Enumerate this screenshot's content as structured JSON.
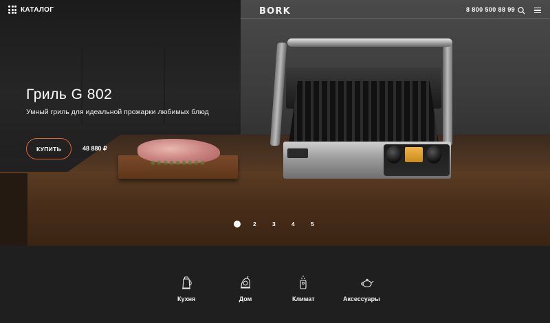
{
  "header": {
    "catalog_label": "КАТАЛОГ",
    "logo": "BORK",
    "phone": "8 800 500 88 99",
    "icons": [
      "grid-dots-icon",
      "search-icon",
      "menu-icon"
    ]
  },
  "hero": {
    "title": "Гриль G 802",
    "description": "Умный гриль для идеальной прожарки любимых блюд",
    "buy_label": "КУПИТЬ",
    "price": "48 880 ₽",
    "accent_color": "#e0662a"
  },
  "pagination": {
    "active": 1,
    "pages": [
      "2",
      "3",
      "4",
      "5"
    ]
  },
  "categories": [
    {
      "label": "Кухня",
      "icon": "kettle-icon"
    },
    {
      "label": "Дом",
      "icon": "vacuum-icon"
    },
    {
      "label": "Климат",
      "icon": "humidifier-icon"
    },
    {
      "label": "Аксессуары",
      "icon": "teapot-icon"
    }
  ]
}
